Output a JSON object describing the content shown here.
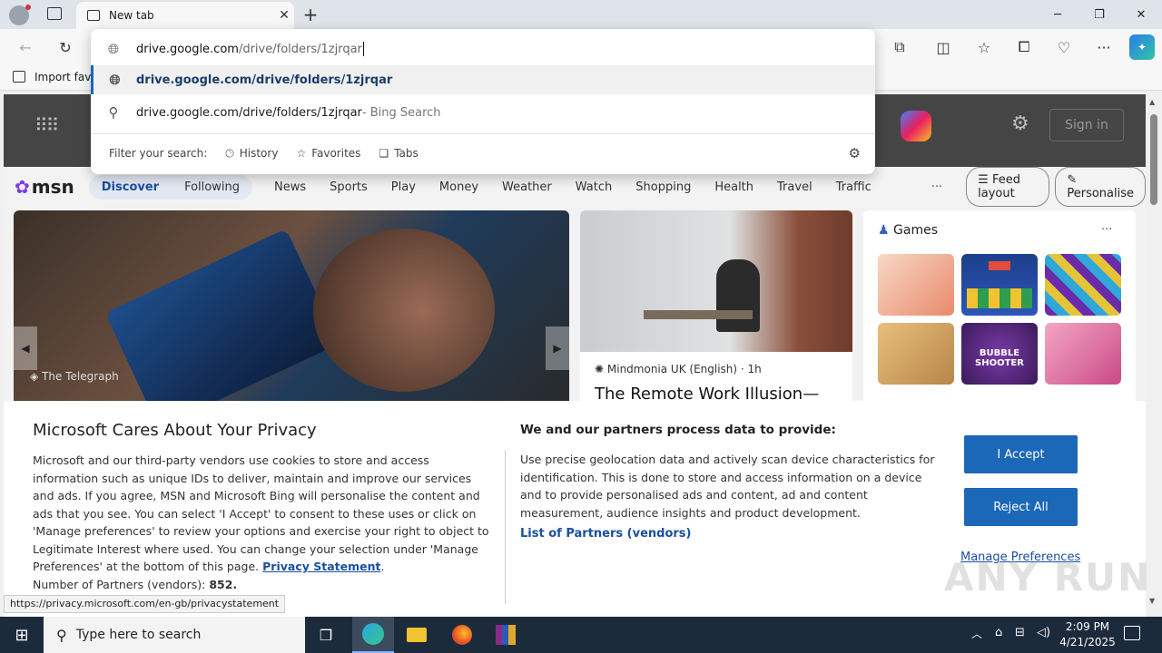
{
  "browser": {
    "tab_title": "New tab",
    "address_text_domain": "drive.google.com",
    "address_text_path": "/drive/folders/1zjrqar",
    "favorites_import": "Import favo"
  },
  "dropdown": {
    "suggestion_bold": "drive.google.com/drive/folders/1zjrqar",
    "search_query": "drive.google.com/drive/folders/1zjrqar",
    "search_suffix": " - Bing Search",
    "filter_label": "Filter your search:",
    "filters": [
      "History",
      "Favorites",
      "Tabs"
    ]
  },
  "msn": {
    "logo": "msn",
    "signin": "Sign in",
    "nav": [
      "Discover",
      "Following",
      "News",
      "Sports",
      "Play",
      "Money",
      "Weather",
      "Watch",
      "Shopping",
      "Health",
      "Travel",
      "Traffic"
    ],
    "more": "···",
    "feed_layout": "Feed layout",
    "personalise": "Personalise",
    "hero_source": "The Telegraph",
    "card2_source": "Mindmonia UK (English)",
    "card2_time": "· 1h",
    "card2_title": "The Remote Work Illusion—",
    "games_title": "Games",
    "games_more": "···",
    "bubble_label": "BUBBLE SHOOTER"
  },
  "privacy": {
    "title": "Microsoft Cares About Your Privacy",
    "body": "Microsoft and our third-party vendors use cookies to store and access information such as unique IDs to deliver, maintain and improve our services and ads. If you agree, MSN and Microsoft Bing will personalise the content and ads that you see. You can select 'I Accept' to consent to these uses or click on 'Manage preferences' to review your options and exercise your right to object to Legitimate Interest where used.  You can change your selection under 'Manage Preferences' at the bottom of this page.",
    "privacy_link": "Privacy Statement",
    "partners_label": "Number of Partners (vendors):",
    "partners_count": "852.",
    "right_title": "We and our partners process data to provide:",
    "right_body": "Use precise geolocation data and actively scan device characteristics for identification. This is done to store and access information on a device and to provide personalised ads and content, ad and content measurement, audience insights and product development.",
    "list_partners": "List of Partners (vendors)",
    "accept": "I Accept",
    "reject": "Reject All",
    "manage": "Manage Preferences"
  },
  "status_url": "https://privacy.microsoft.com/en-gb/privacystatement",
  "watermark": "ANY RUN",
  "taskbar": {
    "search_placeholder": "Type here to search",
    "time": "2:09 PM",
    "date": "4/21/2025"
  }
}
